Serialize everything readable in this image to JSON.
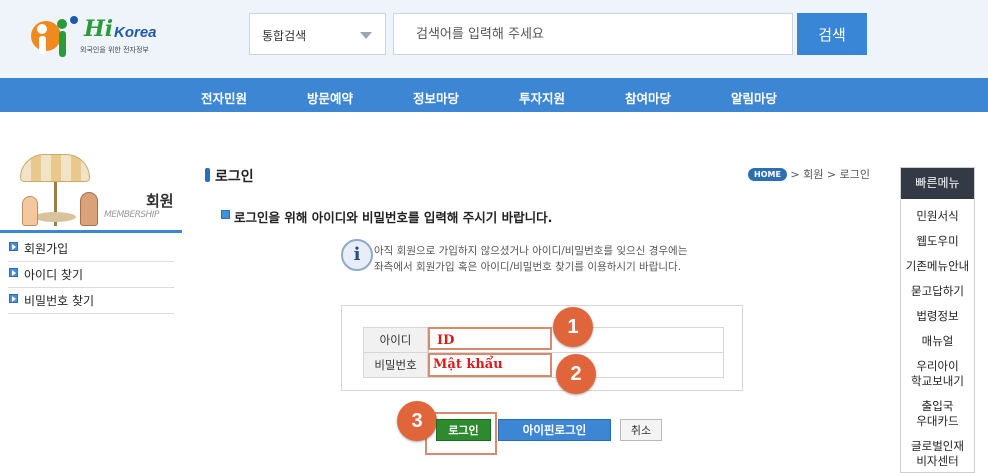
{
  "header": {
    "logo_text": "Hi",
    "logo_text2": "Korea",
    "logo_tagline": "외국인을 위한 전자정부",
    "search_scope": "통합검색",
    "search_placeholder": "검색어를 입력해 주세요",
    "search_button": "검색"
  },
  "nav": {
    "items": [
      "전자민원",
      "방문예약",
      "정보마당",
      "투자지원",
      "참여마당",
      "알림마당"
    ]
  },
  "sidebar": {
    "title": "회원",
    "subtitle": "MEMBERSHIP",
    "items": [
      "회원가입",
      "아이디 찾기",
      "비밀번호 찾기"
    ]
  },
  "main": {
    "page_title": "로그인",
    "breadcrumb_home": "HOME",
    "breadcrumb_rest": " > 회원 > 로그인",
    "instruction": "로그인을 위해 아이디와 비밀번호를 입력해 주시기 바랍니다.",
    "info_line1": "아직 회원으로 가입하지 않으셨거나 아이디/비밀번호를 잊으신 경우에는",
    "info_line2": "좌측에서 회원가입 혹은 아이디/비밀번호 찾기를 이용하시기 바랍니다.",
    "id_label": "아이디",
    "pw_label": "비밀번호",
    "id_annotation": "ID",
    "pw_annotation": "Mật khẩu",
    "login_button": "로그인",
    "ipin_button": "아이핀로그인",
    "cancel_button": "취소"
  },
  "annotations": {
    "badge1": "1",
    "badge2": "2",
    "badge3": "3",
    "badge_color": "#e0653a",
    "label_color": "#d81b1b"
  },
  "quick_menu": {
    "title": "빠른메뉴",
    "items": [
      "민원서식",
      "웹도우미",
      "기존메뉴안내",
      "묻고답하기",
      "법령정보",
      "매뉴얼",
      "우리아이\n학교보내기",
      "출입국\n우대카드",
      "글로벌인재\n비자센터"
    ]
  },
  "colors": {
    "header_bg": "#eff3fa",
    "nav_bg": "#3c86d4",
    "login_green": "#2d8a2f"
  }
}
